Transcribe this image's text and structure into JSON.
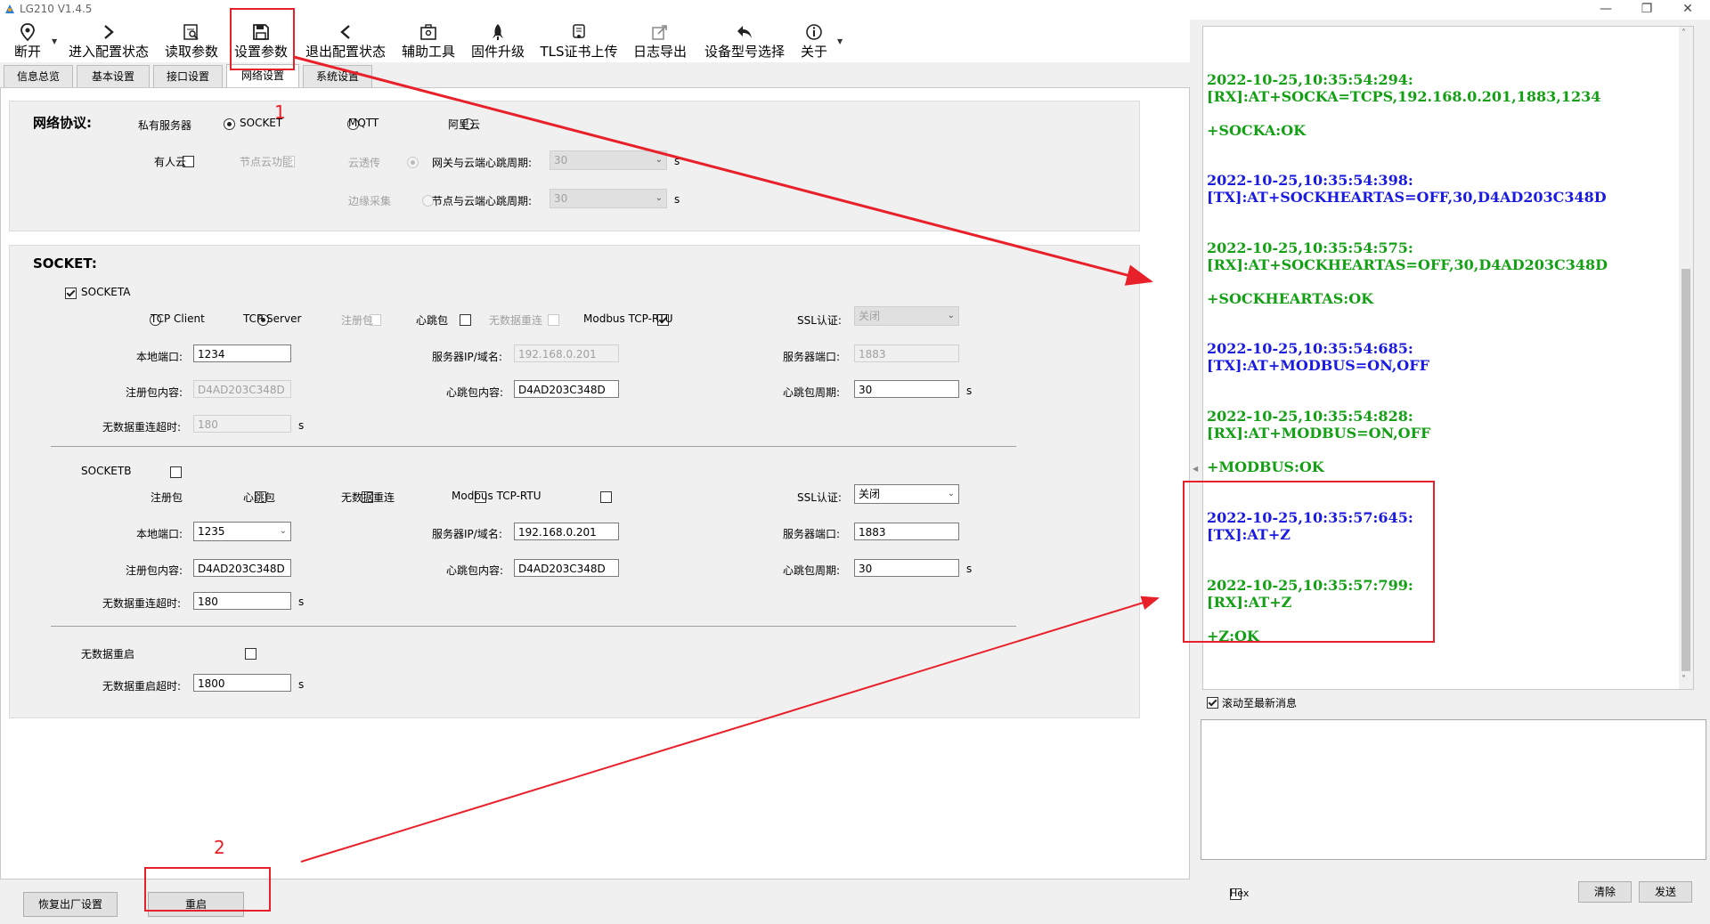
{
  "window": {
    "title": "LG210 V1.4.5"
  },
  "toolbar": [
    {
      "id": "disconnect",
      "label": "断开",
      "icon": "location-pin-icon"
    },
    {
      "id": "enter-config",
      "label": "进入配置状态",
      "icon": "chevron-right-icon"
    },
    {
      "id": "read-params",
      "label": "读取参数",
      "icon": "read-doc-icon"
    },
    {
      "id": "set-params",
      "label": "设置参数",
      "icon": "save-icon"
    },
    {
      "id": "exit-config",
      "label": "退出配置状态",
      "icon": "chevron-left-icon"
    },
    {
      "id": "aux-tools",
      "label": "辅助工具",
      "icon": "toolbox-icon"
    },
    {
      "id": "firmware",
      "label": "固件升级",
      "icon": "rocket-icon"
    },
    {
      "id": "tls",
      "label": "TLS证书上传",
      "icon": "certificate-icon"
    },
    {
      "id": "log-export",
      "label": "日志导出",
      "icon": "export-icon"
    },
    {
      "id": "device-model",
      "label": "设备型号选择",
      "icon": "undo-arrow-icon"
    },
    {
      "id": "about",
      "label": "关于",
      "icon": "info-icon"
    }
  ],
  "tabs": [
    "信息总览",
    "基本设置",
    "接口设置",
    "网络设置",
    "系统设置"
  ],
  "active_tab": "网络设置",
  "protocol": {
    "title": "网络协议:",
    "private_server": "私有服务器",
    "opt_socket": "SOCKET",
    "opt_mqtt": "MQTT",
    "opt_aliyun": "阿里云",
    "opt_youren": "有人云",
    "node_cloud": "节点云功能",
    "cloud_transparent": "云透传",
    "edge_collect": "边缘采集",
    "gw_heartbeat_label": "网关与云端心跳周期:",
    "gw_heartbeat_value": "30",
    "node_heartbeat_label": "节点与云端心跳周期:",
    "node_heartbeat_value": "30",
    "unit_s": "s"
  },
  "socket": {
    "title": "SOCKET:",
    "a": {
      "name": "SOCKETA",
      "tcp_client": "TCP Client",
      "tcp_server": "TCP Server",
      "reg_pkt": "注册包",
      "heartbeat": "心跳包",
      "no_data_reconnect": "无数据重连",
      "modbus": "Modbus TCP-RTU",
      "ssl_label": "SSL认证:",
      "ssl_value": "关闭",
      "local_port_label": "本地端口:",
      "local_port": "1234",
      "server_ip_label": "服务器IP/域名:",
      "server_ip": "192.168.0.201",
      "server_port_label": "服务器端口:",
      "server_port": "1883",
      "reg_content_label": "注册包内容:",
      "reg_content": "D4AD203C348D",
      "hb_content_label": "心跳包内容:",
      "hb_content": "D4AD203C348D",
      "hb_period_label": "心跳包周期:",
      "hb_period": "30",
      "timeout_label": "无数据重连超时:",
      "timeout": "180",
      "unit_s": "s"
    },
    "b": {
      "name": "SOCKETB",
      "reg_pkt": "注册包",
      "heartbeat": "心跳包",
      "no_data_reconnect": "无数据重连",
      "modbus": "Modbus TCP-RTU",
      "ssl_label": "SSL认证:",
      "ssl_value": "关闭",
      "local_port_label": "本地端口:",
      "local_port": "1235",
      "server_ip_label": "服务器IP/域名:",
      "server_ip": "192.168.0.201",
      "server_port_label": "服务器端口:",
      "server_port": "1883",
      "reg_content_label": "注册包内容:",
      "reg_content": "D4AD203C348D",
      "hb_content_label": "心跳包内容:",
      "hb_content": "D4AD203C348D",
      "hb_period_label": "心跳包周期:",
      "hb_period": "30",
      "timeout_label": "无数据重连超时:",
      "timeout": "180",
      "unit_s": "s"
    },
    "restart": {
      "label": "无数据重启",
      "timeout_label": "无数据重启超时:",
      "timeout": "1800",
      "unit_s": "s"
    }
  },
  "bottom": {
    "factory_reset": "恢复出厂设置",
    "restart": "重启"
  },
  "log": [
    {
      "text": "2022-10-25,10:35:54:294:",
      "color": "green"
    },
    {
      "text": "[RX]:AT+SOCKA=TCPS,192.168.0.201,1883,1234",
      "color": "green"
    },
    {
      "text": "+SOCKA:OK",
      "color": "green"
    },
    {
      "text": "2022-10-25,10:35:54:398:",
      "color": "blue"
    },
    {
      "text": "[TX]:AT+SOCKHEARTAS=OFF,30,D4AD203C348D",
      "color": "blue"
    },
    {
      "text": "2022-10-25,10:35:54:575:",
      "color": "green"
    },
    {
      "text": "[RX]:AT+SOCKHEARTAS=OFF,30,D4AD203C348D",
      "color": "green"
    },
    {
      "text": "+SOCKHEARTAS:OK",
      "color": "green"
    },
    {
      "text": "2022-10-25,10:35:54:685:",
      "color": "blue"
    },
    {
      "text": "[TX]:AT+MODBUS=ON,OFF",
      "color": "blue"
    },
    {
      "text": "2022-10-25,10:35:54:828:",
      "color": "green"
    },
    {
      "text": "[RX]:AT+MODBUS=ON,OFF",
      "color": "green"
    },
    {
      "text": "+MODBUS:OK",
      "color": "green"
    },
    {
      "text": "2022-10-25,10:35:57:645:",
      "color": "blue"
    },
    {
      "text": "[TX]:AT+Z",
      "color": "blue"
    },
    {
      "text": "2022-10-25,10:35:57:799:",
      "color": "green"
    },
    {
      "text": "[RX]:AT+Z",
      "color": "green"
    },
    {
      "text": "+Z:OK",
      "color": "green"
    }
  ],
  "log_controls": {
    "autoscroll": "滚动至最新消息",
    "hex": "Hex",
    "clear": "清除",
    "send": "发送"
  },
  "annotations": {
    "step1": "1",
    "step2": "2"
  },
  "colors": {
    "annotation": "#e8202a",
    "rx": "#14a014",
    "tx": "#1a1ae0"
  }
}
